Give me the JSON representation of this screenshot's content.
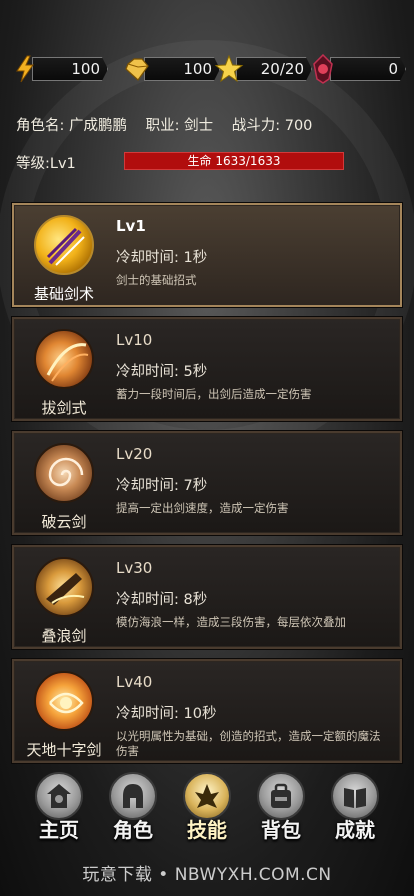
{
  "resources": {
    "energy": "100",
    "gem": "100",
    "stars": "20/20",
    "crystal": "0"
  },
  "character": {
    "name": "角色名: 广成鹏鹏",
    "class": "职业: 剑士",
    "power": "战斗力: 700",
    "level": "等级:Lv1",
    "hp_text": "生命 1633/1633",
    "hp_fraction": 1.0
  },
  "skills": [
    {
      "name": "基础剑术",
      "level": "Lv1",
      "cooldown": "冷却时间: 1秒",
      "desc": "剑士的基础招式",
      "icon": "sword-icon"
    },
    {
      "name": "拔剑式",
      "level": "Lv10",
      "cooldown": "冷却时间: 5秒",
      "desc": "蓄力一段时间后，出剑后造成一定伤害",
      "icon": "slash-icon"
    },
    {
      "name": "破云剑",
      "level": "Lv20",
      "cooldown": "冷却时间: 7秒",
      "desc": "提高一定出剑速度，造成一定伤害",
      "icon": "swirl-icon"
    },
    {
      "name": "叠浪剑",
      "level": "Lv30",
      "cooldown": "冷却时间: 8秒",
      "desc": "模仿海浪一样，造成三段伤害，每层依次叠加",
      "icon": "wave-icon"
    },
    {
      "name": "天地十字剑",
      "level": "Lv40",
      "cooldown": "冷却时间: 10秒",
      "desc": "以光明属性为基础，创造的招式，造成一定额的魔法伤害",
      "icon": "cross-icon"
    }
  ],
  "nav": [
    {
      "label": "主页",
      "icon": "home-icon"
    },
    {
      "label": "角色",
      "icon": "helmet-icon"
    },
    {
      "label": "技能",
      "icon": "skill-icon"
    },
    {
      "label": "背包",
      "icon": "backpack-icon"
    },
    {
      "label": "成就",
      "icon": "book-icon"
    }
  ],
  "watermark": "玩意下载 • NBWYXH.COM.CN",
  "colors": {
    "hp_bar": "#b10d0d",
    "active_border": "#a5865b",
    "card_border": "#4a3b2e"
  }
}
